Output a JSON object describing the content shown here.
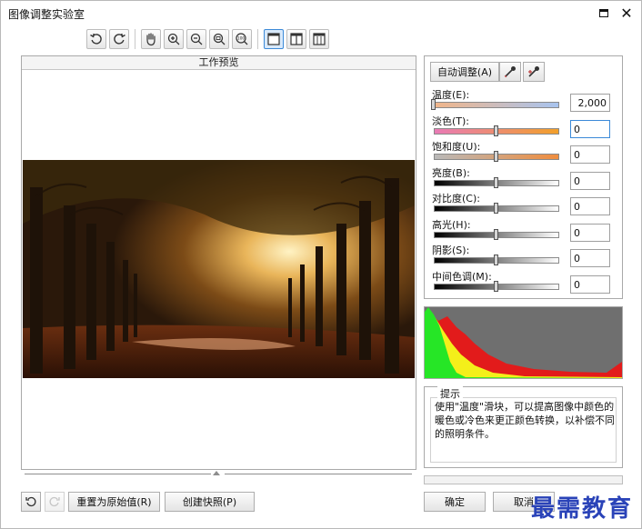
{
  "window": {
    "title": "图像调整实验室"
  },
  "preview": {
    "header": "工作预览"
  },
  "adjust": {
    "auto_label": "自动调整(A)",
    "sliders": [
      {
        "label": "温度(E):",
        "value": "2,000",
        "level": 0.0,
        "gradient": [
          "#f0b58a",
          "#a8c4ef"
        ]
      },
      {
        "label": "淡色(T):",
        "value": "0",
        "level": 0.5,
        "gradient": [
          "#e97bb6",
          "#f2a02a"
        ]
      },
      {
        "label": "饱和度(U):",
        "value": "0",
        "level": 0.5,
        "gradient": [
          "#b9b9b9",
          "#f08d3e"
        ]
      },
      {
        "label": "亮度(B):",
        "value": "0",
        "level": 0.5,
        "gradient": [
          "#000000",
          "#ffffff"
        ]
      },
      {
        "label": "对比度(C):",
        "value": "0",
        "level": 0.5,
        "gradient": [
          "#000000",
          "#ffffff"
        ]
      },
      {
        "label": "高光(H):",
        "value": "0",
        "level": 0.5,
        "gradient": [
          "#000000",
          "#ffffff"
        ]
      },
      {
        "label": "阴影(S):",
        "value": "0",
        "level": 0.5,
        "gradient": [
          "#000000",
          "#ffffff"
        ]
      },
      {
        "label": "中间色调(M):",
        "value": "0",
        "level": 0.5,
        "gradient": [
          "#000000",
          "#ffffff"
        ]
      }
    ]
  },
  "hint": {
    "title": "提示",
    "text": "使用\"温度\"滑块，可以提高图像中颜色的暖色或冷色来更正颜色转换，以补偿不同的照明条件。"
  },
  "buttons": {
    "reset": "重置为原始值(R)",
    "snapshot": "创建快照(P)",
    "ok": "确定",
    "cancel": "取消"
  },
  "watermark": "最需教育",
  "colors": {
    "accent": "#3c8ad8",
    "watermark": "#2a43b8",
    "hist_bg": "#6f6f6f"
  }
}
